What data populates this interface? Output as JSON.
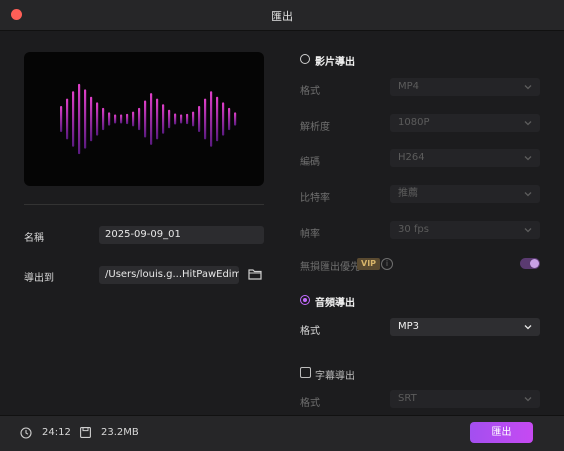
{
  "window": {
    "title": "匯出"
  },
  "media": {
    "name_label": "名稱",
    "name_value": "2025-09-09_01",
    "export_to_label": "導出到",
    "export_path": "/Users/louis.g...HitPawEdimakor"
  },
  "video_export": {
    "label": "影片導出",
    "selected": false,
    "rows": [
      {
        "label": "格式",
        "value": "MP4"
      },
      {
        "label": "解析度",
        "value": "1080P"
      },
      {
        "label": "編碼",
        "value": "H264"
      },
      {
        "label": "比特率",
        "value": "推薦"
      },
      {
        "label": "幀率",
        "value": "30  fps"
      }
    ],
    "hw_label": "無損匯出優先",
    "vip_badge": "VIP",
    "info": "i"
  },
  "audio_export": {
    "label": "音頻導出",
    "selected": true,
    "format_label": "格式",
    "format_value": "MP3"
  },
  "subtitle_export": {
    "label": "字幕導出",
    "checked": false,
    "format_label": "格式",
    "format_value": "SRT"
  },
  "footer": {
    "duration": "24:12",
    "size": "23.2MB",
    "export_button": "匯出"
  },
  "colors": {
    "accent": "#c36bff",
    "wave_top": "#e040c8",
    "wave_bottom": "#5a1a80"
  },
  "waveform_levels": [
    0.35,
    0.55,
    0.75,
    0.95,
    0.8,
    0.6,
    0.45,
    0.3,
    0.18,
    0.12,
    0.12,
    0.14,
    0.2,
    0.3,
    0.5,
    0.7,
    0.55,
    0.4,
    0.25,
    0.15,
    0.12,
    0.14,
    0.2,
    0.35,
    0.55,
    0.75,
    0.6,
    0.45,
    0.3,
    0.18
  ]
}
